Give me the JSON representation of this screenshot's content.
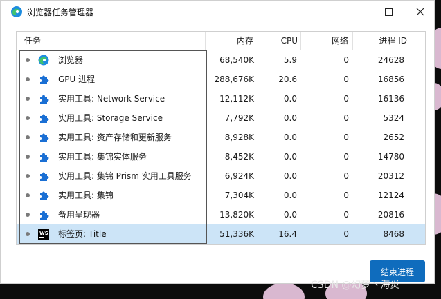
{
  "window": {
    "title": "浏览器任务管理器"
  },
  "columns": {
    "task": "任务",
    "memory": "内存",
    "cpu": "CPU",
    "network": "网络",
    "pid": "进程 ID"
  },
  "rows": [
    {
      "name": "浏览器",
      "memory": "68,540K",
      "cpu": "5.9",
      "network": "0",
      "pid": "24628",
      "icon": "edge-icon"
    },
    {
      "name": "GPU 进程",
      "memory": "288,676K",
      "cpu": "20.6",
      "network": "0",
      "pid": "16856",
      "icon": "puzzle-icon"
    },
    {
      "name": "实用工具: Network Service",
      "memory": "12,112K",
      "cpu": "0.0",
      "network": "0",
      "pid": "16136",
      "icon": "puzzle-icon"
    },
    {
      "name": "实用工具: Storage Service",
      "memory": "7,792K",
      "cpu": "0.0",
      "network": "0",
      "pid": "5324",
      "icon": "puzzle-icon"
    },
    {
      "name": "实用工具: 资产存储和更新服务",
      "memory": "8,928K",
      "cpu": "0.0",
      "network": "0",
      "pid": "2652",
      "icon": "puzzle-icon"
    },
    {
      "name": "实用工具: 集锦实体服务",
      "memory": "8,452K",
      "cpu": "0.0",
      "network": "0",
      "pid": "14780",
      "icon": "puzzle-icon"
    },
    {
      "name": "实用工具: 集锦 Prism 实用工具服务",
      "memory": "6,924K",
      "cpu": "0.0",
      "network": "0",
      "pid": "20312",
      "icon": "puzzle-icon"
    },
    {
      "name": "实用工具: 集锦",
      "memory": "7,304K",
      "cpu": "0.0",
      "network": "0",
      "pid": "12124",
      "icon": "puzzle-icon"
    },
    {
      "name": "备用呈现器",
      "memory": "13,820K",
      "cpu": "0.0",
      "network": "0",
      "pid": "20816",
      "icon": "puzzle-icon"
    },
    {
      "name": "标签页: Title",
      "memory": "51,336K",
      "cpu": "16.4",
      "network": "0",
      "pid": "8468",
      "icon": "webstorm-icon",
      "selected": true
    }
  ],
  "actions": {
    "end_process": "结束进程"
  },
  "watermark": "CSDN @幻梦丶海炎",
  "colors": {
    "accent": "#0f6cbd",
    "selected_row": "#cce4f7",
    "icon_blue": "#1a6fd4"
  }
}
